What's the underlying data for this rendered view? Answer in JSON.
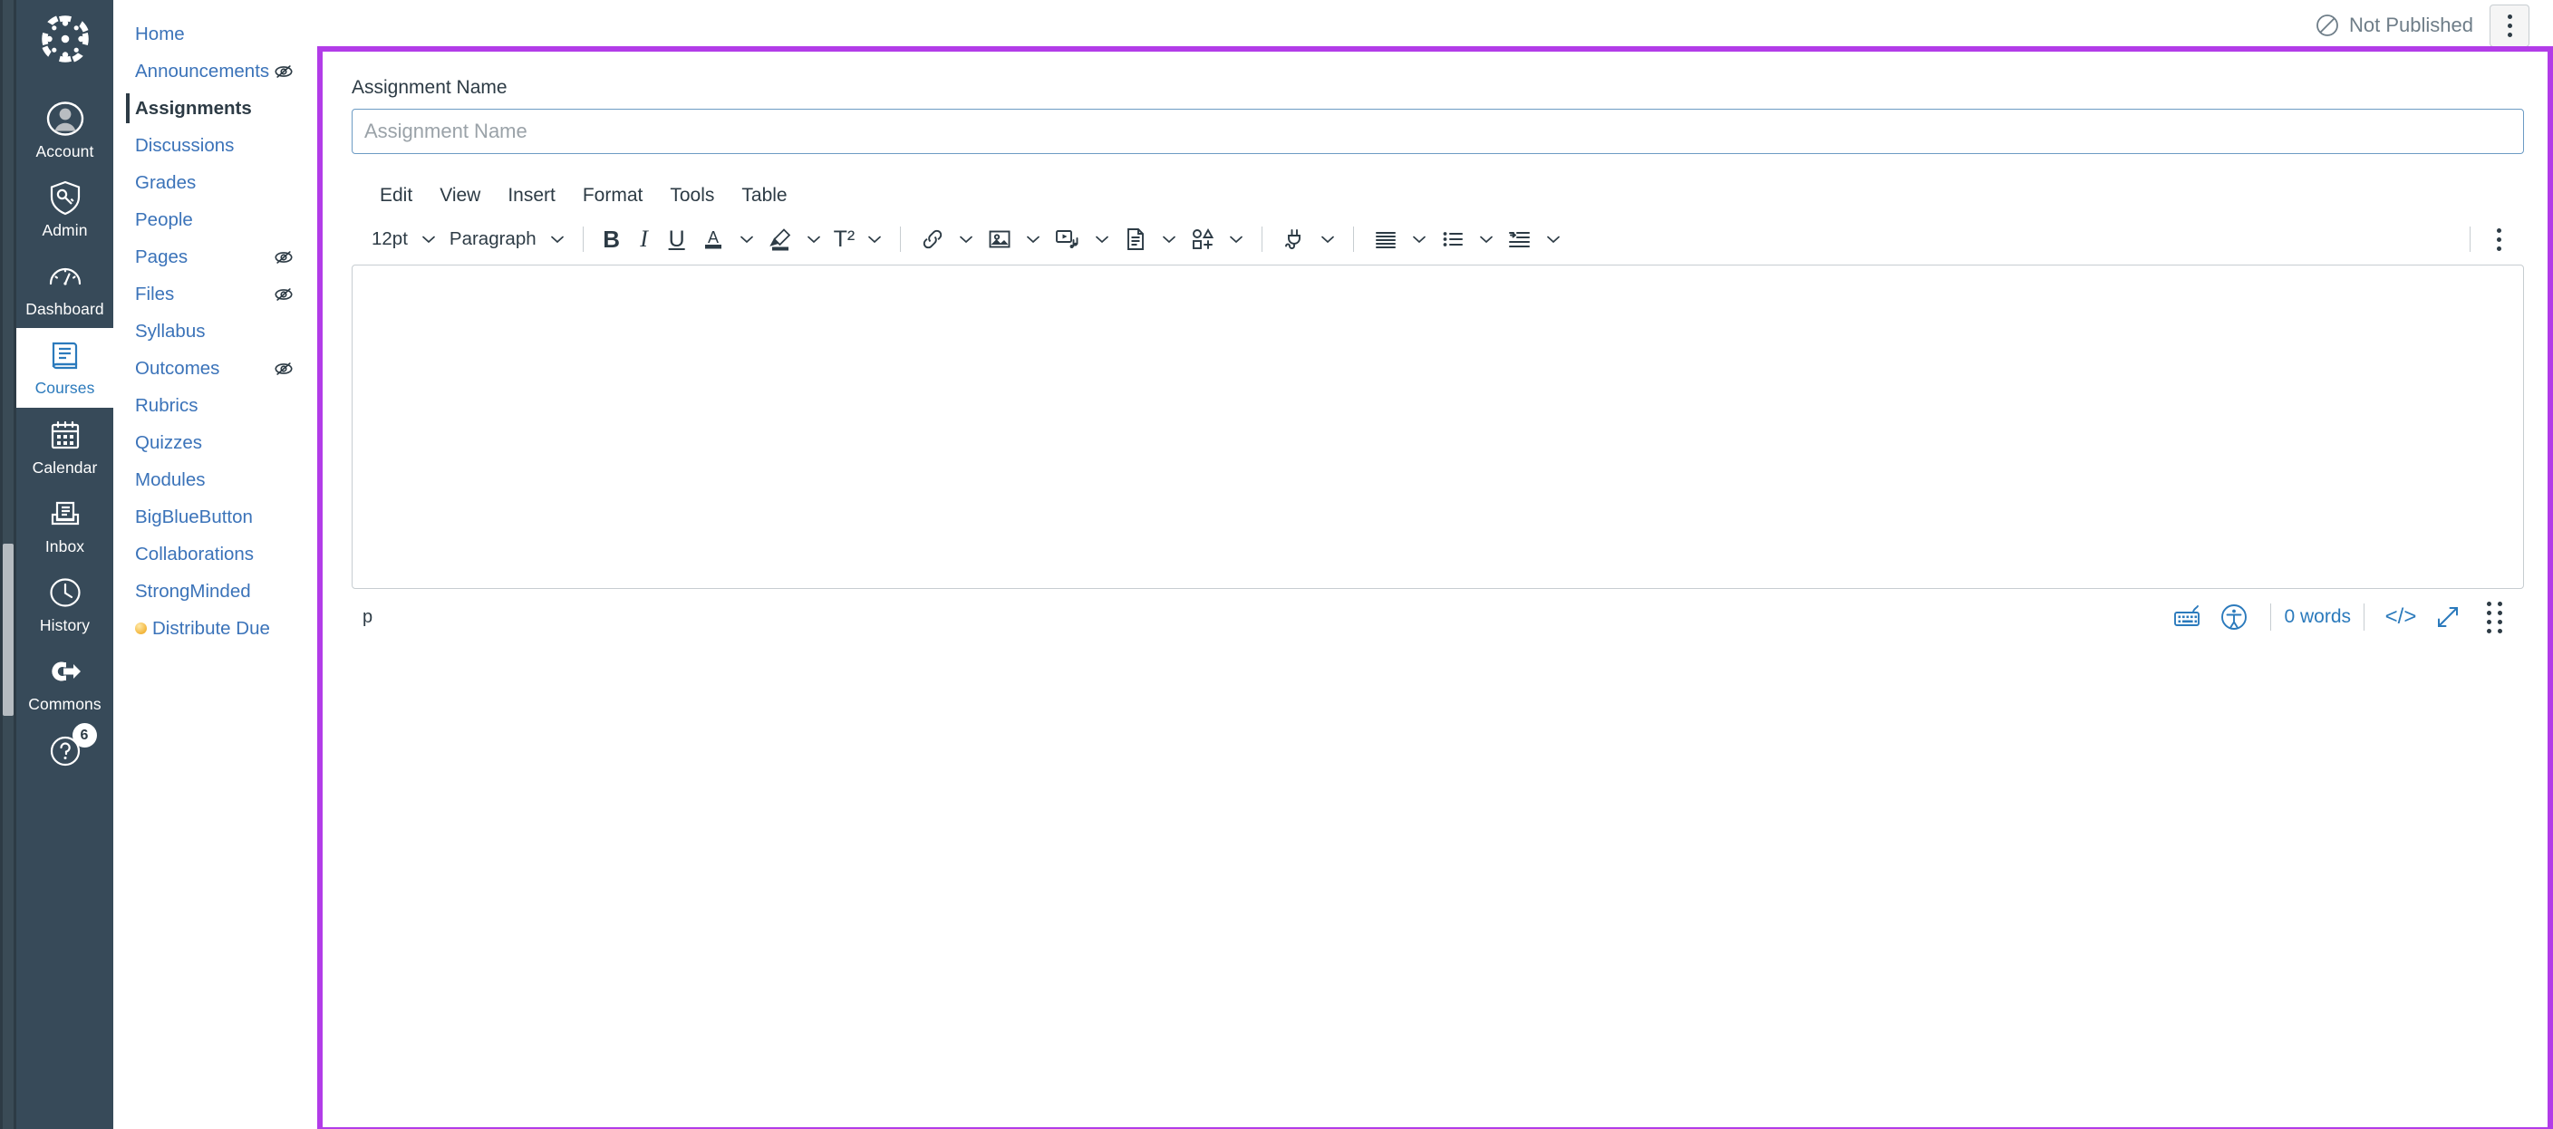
{
  "global_nav": {
    "logo_name": "canvas-logo",
    "items": [
      {
        "label": "Account",
        "icon": "account-avatar-icon",
        "active": false
      },
      {
        "label": "Admin",
        "icon": "shield-key-icon",
        "active": false
      },
      {
        "label": "Dashboard",
        "icon": "dashboard-gauge-icon",
        "active": false
      },
      {
        "label": "Courses",
        "icon": "courses-book-icon",
        "active": true
      },
      {
        "label": "Calendar",
        "icon": "calendar-icon",
        "active": false
      },
      {
        "label": "Inbox",
        "icon": "inbox-tray-icon",
        "active": false
      },
      {
        "label": "History",
        "icon": "clock-icon",
        "active": false
      },
      {
        "label": "Commons",
        "icon": "commons-export-icon",
        "active": false
      }
    ],
    "help": {
      "icon": "help-question-icon",
      "badge": "6"
    }
  },
  "course_nav": {
    "items": [
      {
        "label": "Home",
        "active": false,
        "hidden_icon": false,
        "dot": false
      },
      {
        "label": "Announcements",
        "active": false,
        "hidden_icon": true,
        "dot": false
      },
      {
        "label": "Assignments",
        "active": true,
        "hidden_icon": false,
        "dot": false
      },
      {
        "label": "Discussions",
        "active": false,
        "hidden_icon": false,
        "dot": false
      },
      {
        "label": "Grades",
        "active": false,
        "hidden_icon": false,
        "dot": false
      },
      {
        "label": "People",
        "active": false,
        "hidden_icon": false,
        "dot": false
      },
      {
        "label": "Pages",
        "active": false,
        "hidden_icon": true,
        "dot": false
      },
      {
        "label": "Files",
        "active": false,
        "hidden_icon": true,
        "dot": false
      },
      {
        "label": "Syllabus",
        "active": false,
        "hidden_icon": false,
        "dot": false
      },
      {
        "label": "Outcomes",
        "active": false,
        "hidden_icon": true,
        "dot": false
      },
      {
        "label": "Rubrics",
        "active": false,
        "hidden_icon": false,
        "dot": false
      },
      {
        "label": "Quizzes",
        "active": false,
        "hidden_icon": false,
        "dot": false
      },
      {
        "label": "Modules",
        "active": false,
        "hidden_icon": false,
        "dot": false
      },
      {
        "label": "BigBlueButton",
        "active": false,
        "hidden_icon": false,
        "dot": false
      },
      {
        "label": "Collaborations",
        "active": false,
        "hidden_icon": false,
        "dot": false
      },
      {
        "label": "StrongMinded",
        "active": false,
        "hidden_icon": false,
        "dot": false
      },
      {
        "label": "Distribute Due",
        "active": false,
        "hidden_icon": false,
        "dot": true
      }
    ]
  },
  "header": {
    "publish_status": "Not Published",
    "publish_icon": "no-entry-circle-icon",
    "kebab_name": "more-options-button"
  },
  "form": {
    "assignment_name_label": "Assignment Name",
    "assignment_name_value": "",
    "assignment_name_placeholder": "Assignment Name"
  },
  "rce": {
    "menus": [
      "Edit",
      "View",
      "Insert",
      "Format",
      "Tools",
      "Table"
    ],
    "toolbar": {
      "font_size": "12pt",
      "block_format": "Paragraph",
      "bold": "B",
      "italic": "I",
      "underline": "U",
      "superscript": "T²",
      "icons": [
        "text-color-icon",
        "highlight-color-icon",
        "superscript-icon",
        "link-icon",
        "image-icon",
        "media-icon",
        "document-icon",
        "apps-shapes-icon",
        "lti-plug-icon",
        "align-icon",
        "bulleted-list-icon",
        "indent-icon",
        "overflow-kebab-icon"
      ]
    },
    "body_content": "",
    "status": {
      "element_path": "p",
      "keyboard_icon": "keyboard-shortcuts-icon",
      "accessibility_icon": "accessibility-checker-icon",
      "word_count": "0 words",
      "html_editor_icon": "html-editor-icon",
      "fullscreen_icon": "fullscreen-arrows-icon",
      "resize_grip_icon": "resize-grip-icon"
    }
  },
  "colors": {
    "global_nav_bg": "#374A59",
    "link_blue": "#3B73B9",
    "accent_blue": "#2B7ABC",
    "highlight_purple": "#B23CE8",
    "text_dark": "#2D3B45",
    "muted_gray": "#6E7D88",
    "border_gray": "#C7CDD1"
  }
}
